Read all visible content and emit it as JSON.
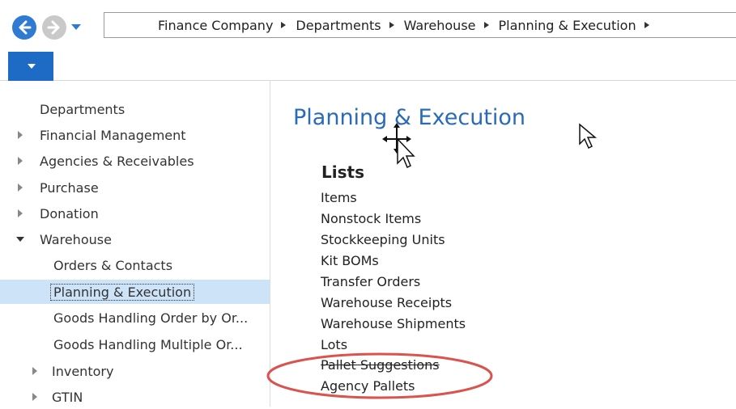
{
  "breadcrumb": [
    "Finance Company",
    "Departments",
    "Warehouse",
    "Planning & Execution"
  ],
  "sidebar": {
    "root": "Departments",
    "items": [
      {
        "label": "Financial Management",
        "state": "collapsed",
        "level": 0
      },
      {
        "label": "Agencies & Receivables",
        "state": "collapsed",
        "level": 0
      },
      {
        "label": "Purchase",
        "state": "collapsed",
        "level": 0
      },
      {
        "label": "Donation",
        "state": "collapsed",
        "level": 0
      },
      {
        "label": "Warehouse",
        "state": "expanded",
        "level": 0
      },
      {
        "label": "Orders & Contacts",
        "state": "leaf",
        "level": 1
      },
      {
        "label": "Planning & Execution",
        "state": "selected",
        "level": 1
      },
      {
        "label": "Goods Handling Order by Or...",
        "state": "leaf",
        "level": 1
      },
      {
        "label": "Goods Handling Multiple Or...",
        "state": "leaf",
        "level": 1
      },
      {
        "label": "Inventory",
        "state": "collapsed",
        "level": 1
      },
      {
        "label": "GTIN",
        "state": "collapsed",
        "level": 1
      }
    ]
  },
  "content": {
    "title": "Planning & Execution",
    "section": "Lists",
    "links": [
      "Items",
      "Nonstock Items",
      "Stockkeeping Units",
      "Kit BOMs",
      "Transfer Orders",
      "Warehouse Receipts",
      "Warehouse Shipments",
      "Lots",
      "Pallet Suggestions",
      "Agency Pallets"
    ]
  },
  "colors": {
    "accent": "#2f7bd2",
    "title": "#2a6bb8",
    "selection": "#cde3f7",
    "highlight_ellipse": "#d9534f"
  },
  "icons": {
    "back": "arrow-left-icon",
    "forward": "arrow-right-icon",
    "menu": "chevron-down-icon"
  }
}
